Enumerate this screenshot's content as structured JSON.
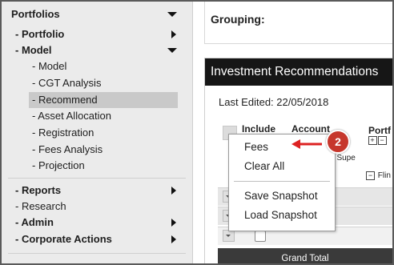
{
  "sidebar": {
    "items": [
      {
        "label": "Portfolios",
        "style": "bold",
        "arrow": "down"
      },
      {
        "label": "- Portfolio",
        "style": "bold",
        "arrow": "right"
      },
      {
        "label": "- Model",
        "style": "bold",
        "arrow": "down"
      },
      {
        "label": "- Model",
        "style": "normal"
      },
      {
        "label": "- CGT Analysis",
        "style": "normal"
      },
      {
        "label": "- Recommend",
        "style": "normal",
        "active": true
      },
      {
        "label": "- Asset Allocation",
        "style": "normal"
      },
      {
        "label": "- Registration",
        "style": "normal"
      },
      {
        "label": "- Fees Analysis",
        "style": "normal"
      },
      {
        "label": "- Projection",
        "style": "normal"
      },
      {
        "label": "- Reports",
        "style": "bold",
        "arrow": "right"
      },
      {
        "label": "- Research",
        "style": "normal"
      },
      {
        "label": "- Admin",
        "style": "bold",
        "arrow": "right"
      },
      {
        "label": "- Corporate Actions",
        "style": "bold",
        "arrow": "right"
      }
    ]
  },
  "main": {
    "grouping_label": "Grouping:",
    "panel_title": "Investment Recommendations",
    "last_edited": "Last Edited: 22/05/2018",
    "columns": {
      "include": "Include",
      "account": "Account",
      "portfolio": "Portf"
    },
    "account_cell": "sterkcy Supe",
    "flin_cell": "Flin",
    "grand_total": "Grand Total"
  },
  "context_menu": {
    "items": [
      "Fees",
      "Clear All",
      "Save Snapshot",
      "Load Snapshot"
    ]
  },
  "callout": {
    "number": "2",
    "color": "#c6372c"
  }
}
